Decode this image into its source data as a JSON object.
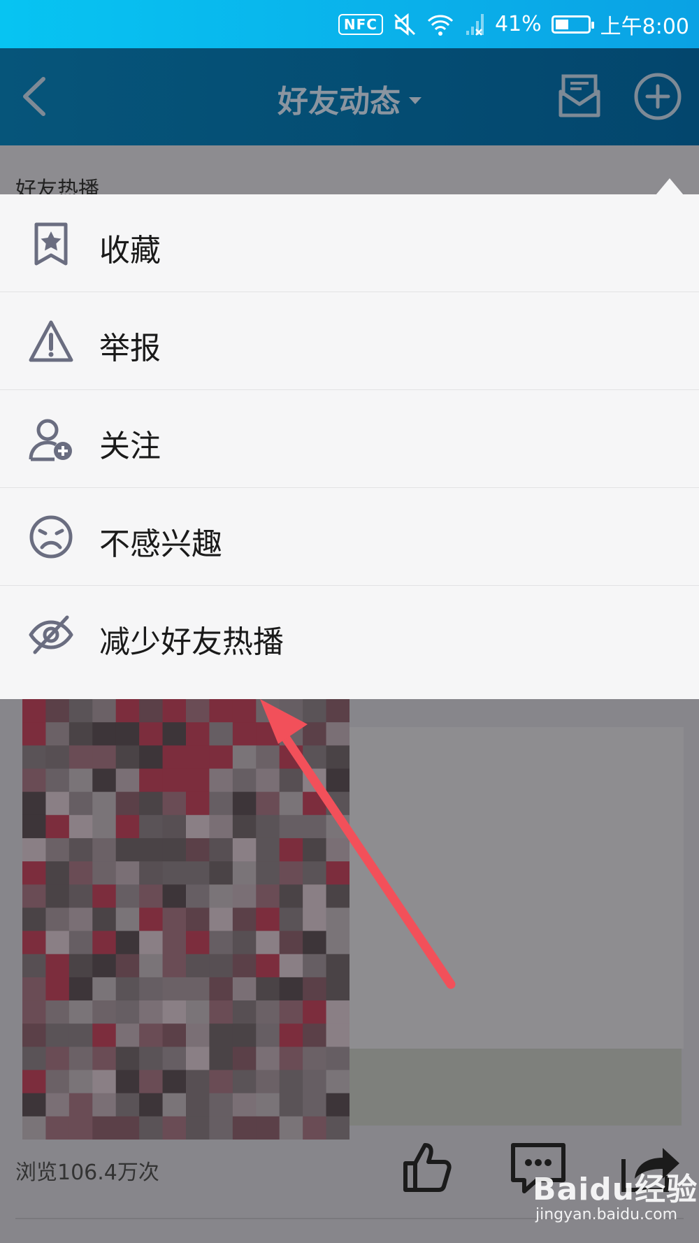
{
  "status_bar": {
    "nfc": "NFC",
    "battery_percent": "41%",
    "battery_level": 0.41,
    "time": "上午8:00"
  },
  "app_bar": {
    "title": "好友动态"
  },
  "sub_header": {
    "title": "好友热播"
  },
  "menu": {
    "items": [
      {
        "label": "收藏",
        "icon": "bookmark-star-icon"
      },
      {
        "label": "举报",
        "icon": "warning-icon"
      },
      {
        "label": "关注",
        "icon": "add-user-icon"
      },
      {
        "label": "不感兴趣",
        "icon": "sad-face-icon"
      },
      {
        "label": "减少好友热播",
        "icon": "eye-off-icon"
      }
    ]
  },
  "feed": {
    "views": "浏览106.4万次"
  },
  "watermark": {
    "logo": "Baidu经验",
    "url": "jingyan.baidu.com"
  },
  "colors": {
    "status_bar": "#0ab0ea",
    "app_bar": "#03466d",
    "menu_bg": "#f6f6f7",
    "annotation_arrow": "#f2505a",
    "icon_stroke": "#6a6d80"
  }
}
